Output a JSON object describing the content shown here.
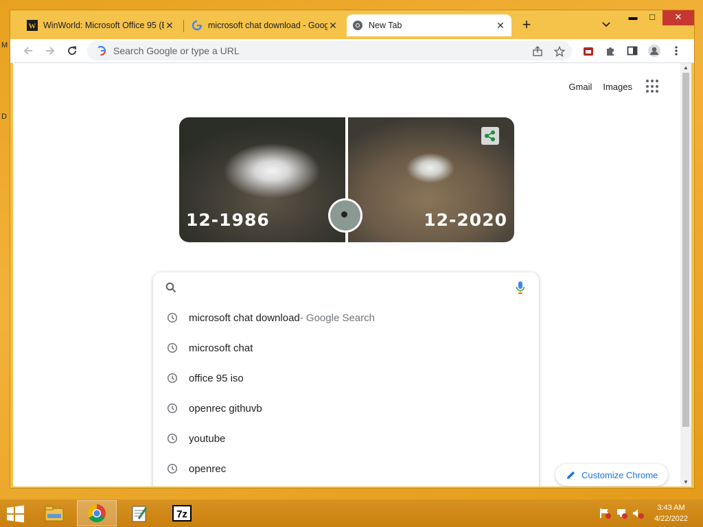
{
  "desktop": {
    "glyph_1": "M",
    "glyph_2": "D"
  },
  "tabs": [
    {
      "title": "WinWorld: Microsoft Office 95 (E",
      "icon": "winworld-logo-icon"
    },
    {
      "title": "microsoft chat download - Goog",
      "icon": "google-g-icon"
    },
    {
      "title": "New Tab",
      "icon": "chrome-icon",
      "active": true
    }
  ],
  "window_controls": {
    "minimize": "▬",
    "maximize": "□",
    "close": "✕"
  },
  "omnibox": {
    "placeholder": "Search Google or type a URL"
  },
  "top_links": {
    "gmail": "Gmail",
    "images": "Images"
  },
  "doodle": {
    "left_date": "12-1986",
    "right_date": "12-2020"
  },
  "suggestions": [
    {
      "text": "microsoft chat download",
      "suffix": " - Google Search"
    },
    {
      "text": "microsoft chat",
      "suffix": ""
    },
    {
      "text": "office 95 iso",
      "suffix": ""
    },
    {
      "text": "openrec githuvb",
      "suffix": ""
    },
    {
      "text": "youtube",
      "suffix": ""
    },
    {
      "text": "openrec",
      "suffix": ""
    }
  ],
  "customize_label": "Customize Chrome",
  "clock": {
    "time": "3:43 AM",
    "date": "4/22/2022"
  },
  "colors": {
    "accent": "#1a73e8",
    "window_frame": "#f5c24a",
    "taskbar": "#d79221"
  }
}
